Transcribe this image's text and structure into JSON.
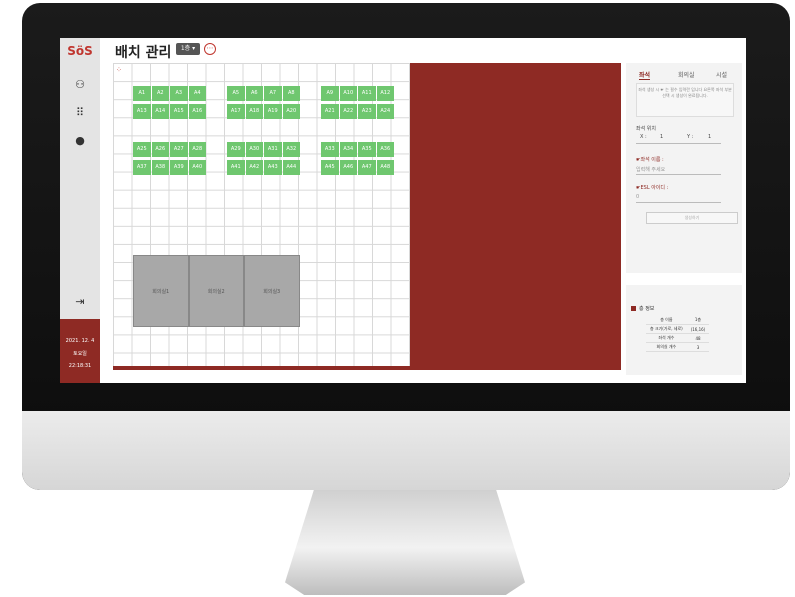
{
  "app": {
    "logo": "SöS",
    "title": "배치 관리"
  },
  "floor_select": {
    "label": "1층 ▾",
    "more": "⋯"
  },
  "sidebar": {
    "icons": [
      "people-icon",
      "grid-icon",
      "chat-icon"
    ],
    "logout_icon": "⇥",
    "date": "2021. 12. 4",
    "weekday": "토요일",
    "time": "22:18:31"
  },
  "seats": {
    "row1": [
      "A1",
      "A2",
      "A3",
      "A4",
      "A5",
      "A6",
      "A7",
      "A8",
      "A9",
      "A10",
      "A11",
      "A12"
    ],
    "row2": [
      "A13",
      "A14",
      "A15",
      "A16",
      "A17",
      "A18",
      "A19",
      "A20",
      "A21",
      "A22",
      "A23",
      "A24"
    ],
    "row3": [
      "A25",
      "A26",
      "A27",
      "A28",
      "A29",
      "A30",
      "A31",
      "A32",
      "A33",
      "A34",
      "A35",
      "A36"
    ],
    "row4": [
      "A37",
      "A38",
      "A39",
      "A40",
      "A41",
      "A42",
      "A43",
      "A44",
      "A45",
      "A46",
      "A47",
      "A48"
    ]
  },
  "rooms": [
    "회의실1",
    "회의실2",
    "회의실3"
  ],
  "panel": {
    "tabs": [
      "좌석",
      "회의실",
      "시설"
    ],
    "notice": "좌석 생성 시 ☛ 는 필수 입력란 입니다 요른쪽 좌석 부분 선택 시 생성이 완료됩니다.",
    "position_label": "좌석 위치",
    "x_label": "X :",
    "x_value": "1",
    "y_label": "Y :",
    "y_value": "1",
    "name_label": "☛좌석 이름 :",
    "name_placeholder": "입력해 주세요",
    "esl_label": "☛ESL 아이디 :",
    "esl_value": "0",
    "apply_label": "생성하기"
  },
  "floor_info": {
    "title": "층 정보",
    "rows": [
      {
        "label": "층 이름",
        "value": "1층"
      },
      {
        "label": "층 크기(가로, 세로)",
        "value": "(16,16)"
      },
      {
        "label": "좌석 개수",
        "value": "48"
      },
      {
        "label": "회의실 개수",
        "value": "3"
      }
    ]
  },
  "colors": {
    "accent": "#8e2a24",
    "seat": "#6fc76f",
    "room": "#a8a8a8"
  }
}
